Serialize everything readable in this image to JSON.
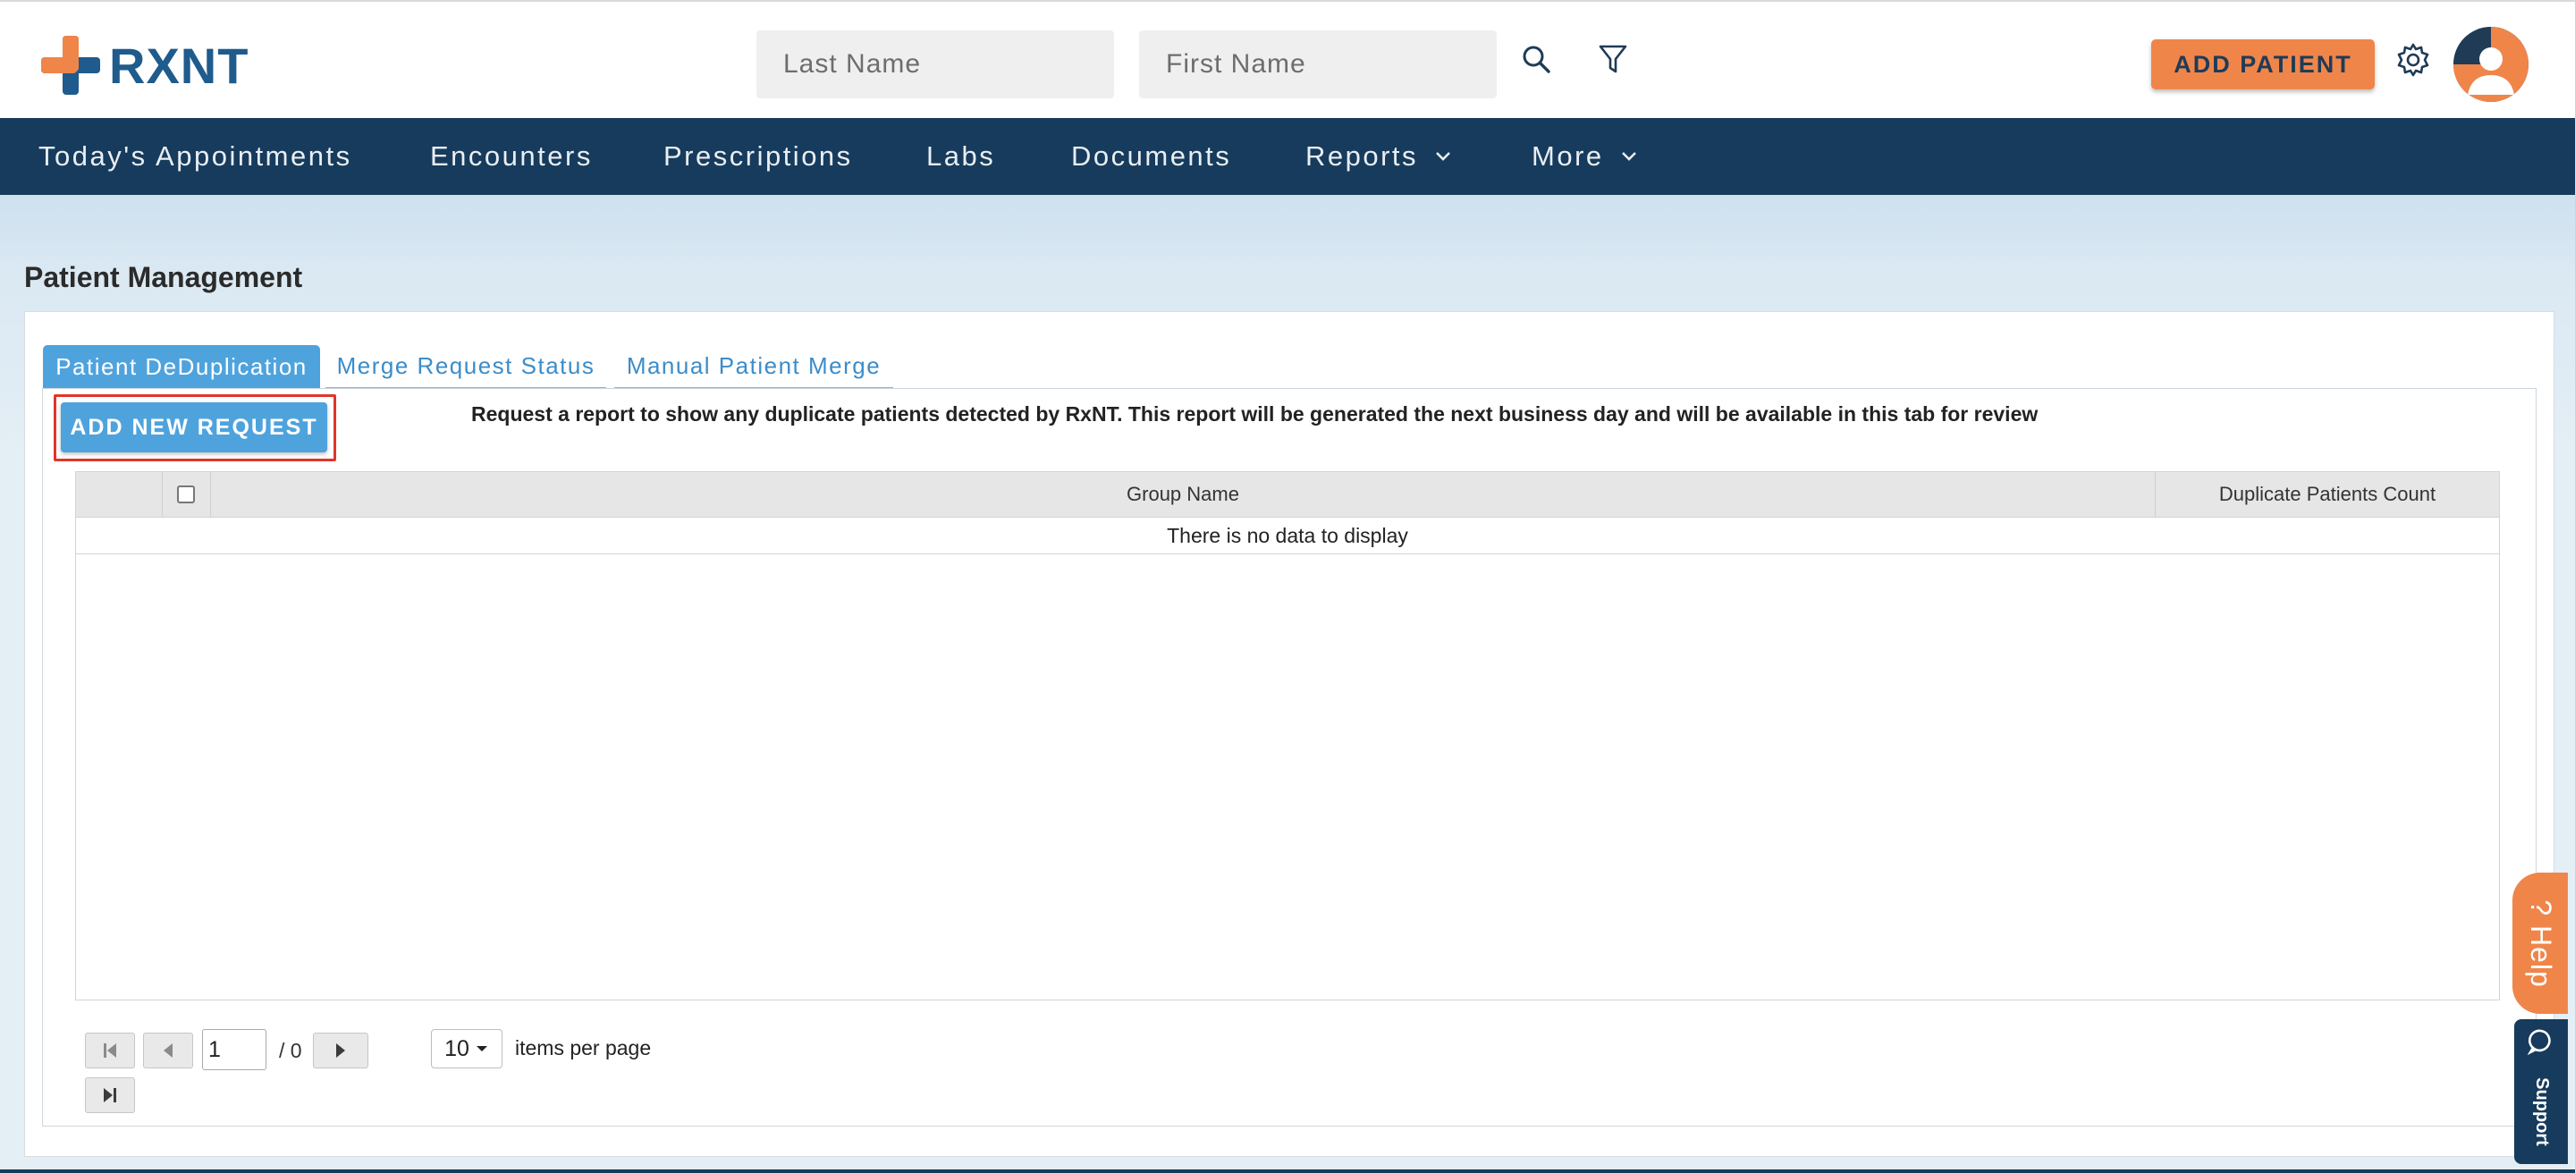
{
  "header": {
    "logo_text": "RXNT",
    "last_name_placeholder": "Last Name",
    "first_name_placeholder": "First Name",
    "add_patient_label": "ADD PATIENT",
    "brand_orange": "#f0854a",
    "brand_navy": "#173b5c"
  },
  "nav": {
    "items": [
      {
        "label": "Today's Appointments"
      },
      {
        "label": "Encounters"
      },
      {
        "label": "Prescriptions"
      },
      {
        "label": "Labs"
      },
      {
        "label": "Documents"
      },
      {
        "label": "Reports",
        "has_dropdown": true
      },
      {
        "label": "More",
        "has_dropdown": true
      }
    ]
  },
  "page": {
    "title": "Patient Management",
    "tabs": [
      {
        "label": "Patient DeDuplication",
        "active": true
      },
      {
        "label": "Merge Request Status",
        "active": false
      },
      {
        "label": "Manual Patient Merge",
        "active": false
      }
    ],
    "add_request_label": "ADD NEW REQUEST",
    "info_text": "Request a report to show any duplicate patients detected by RxNT. This report will be generated the next business day and will be available in this tab for review"
  },
  "grid": {
    "columns": [
      "Group Name",
      "Duplicate Patients Count"
    ],
    "select_all_checked": false,
    "empty_message": "There is no data to display"
  },
  "pager": {
    "current_page": "1",
    "total_pages_text": "/ 0",
    "page_size": "10",
    "items_per_page_label": "items per page"
  },
  "side": {
    "help_label": "? Help",
    "support_label": "Support"
  }
}
